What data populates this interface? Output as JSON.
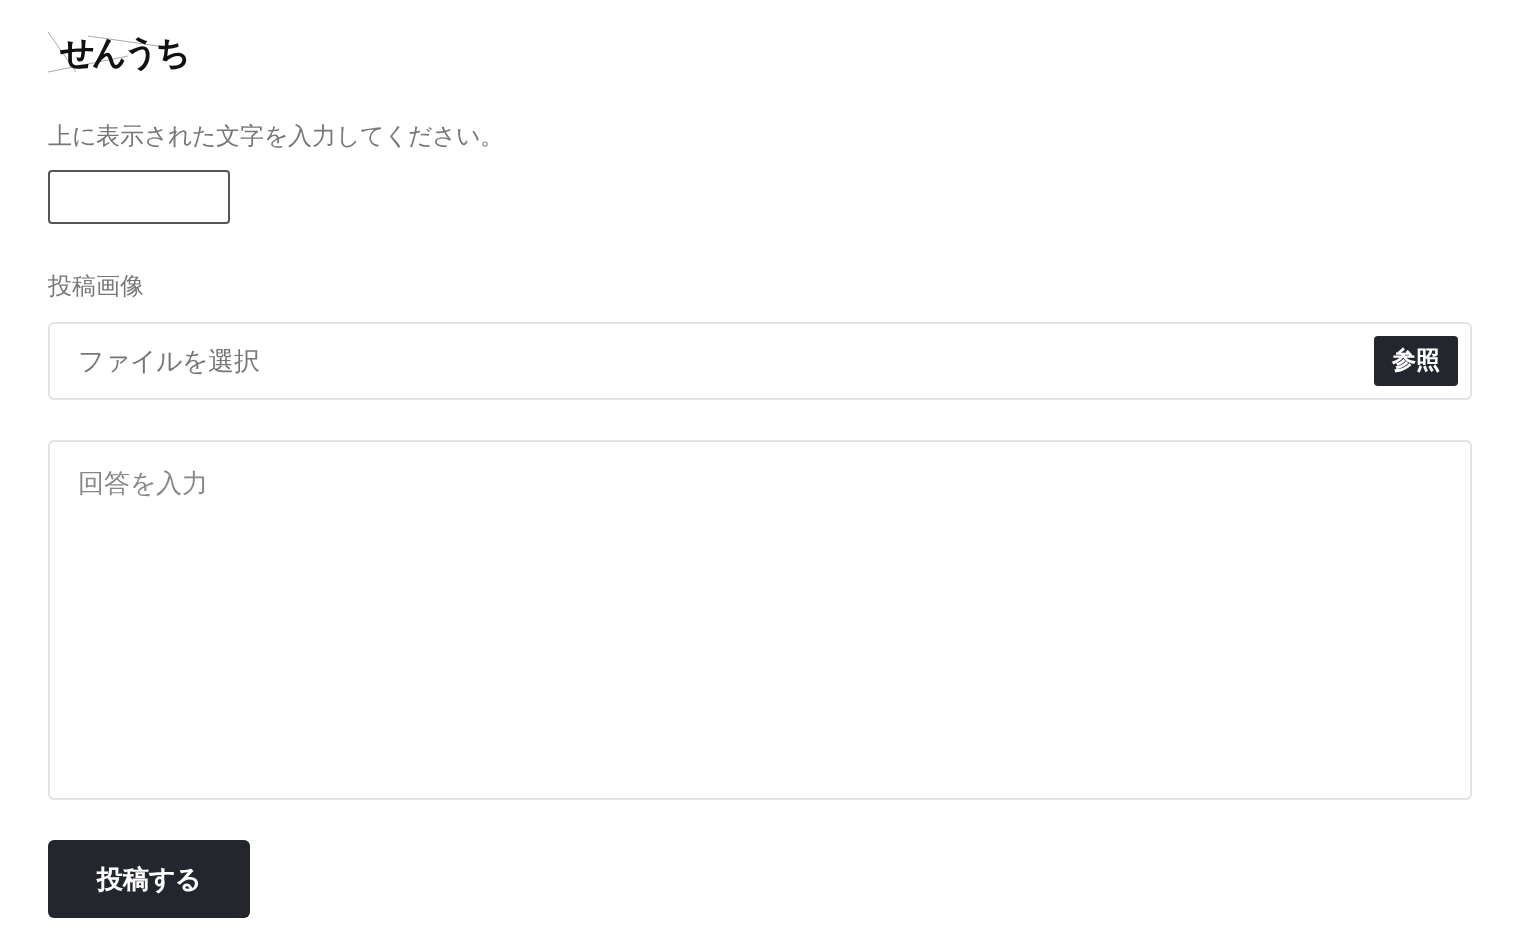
{
  "captcha": {
    "text": "せんうち"
  },
  "captcha_prompt": "上に表示された文字を入力してください。",
  "image_label": "投稿画像",
  "file_field": {
    "placeholder": "ファイルを選択",
    "browse_button": "参照"
  },
  "answer_field": {
    "placeholder": "回答を入力"
  },
  "submit_button": "投稿する"
}
